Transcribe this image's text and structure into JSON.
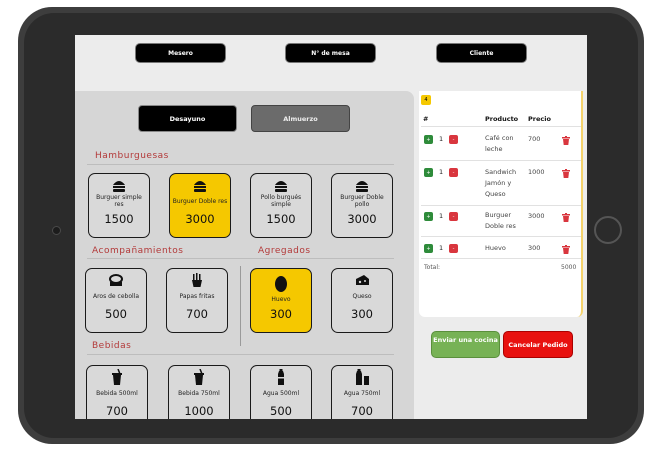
{
  "header": {
    "waiter_label": "Mesero",
    "table_label": "N° de mesa",
    "client_label": "Cliente"
  },
  "tabs": [
    {
      "label": "Desayuno",
      "active": true
    },
    {
      "label": "Almuerzo",
      "active": false
    }
  ],
  "sections": {
    "burgers": "Hamburguesas",
    "sides": "Acompañamientos",
    "extras": "Agregados",
    "drinks": "Bebidas"
  },
  "products": {
    "burgers": [
      {
        "name": "Burguer simple res",
        "price": "1500",
        "icon": "burger-icon",
        "selected": false
      },
      {
        "name": "Burguer Doble res",
        "price": "3000",
        "icon": "burger-icon",
        "selected": true
      },
      {
        "name": "Pollo burgués simple",
        "price": "1500",
        "icon": "burger-icon",
        "selected": false
      },
      {
        "name": "Burguer Doble pollo",
        "price": "3000",
        "icon": "burger-icon",
        "selected": false
      }
    ],
    "sides": [
      {
        "name": "Aros de cebolla",
        "price": "500",
        "icon": "onion-rings-icon",
        "selected": false
      },
      {
        "name": "Papas fritas",
        "price": "700",
        "icon": "fries-icon",
        "selected": false
      }
    ],
    "extras": [
      {
        "name": "Huevo",
        "price": "300",
        "icon": "egg-icon",
        "selected": true
      },
      {
        "name": "Queso",
        "price": "300",
        "icon": "cheese-icon",
        "selected": false
      }
    ],
    "drinks": [
      {
        "name": "Bebida 500ml",
        "price": "700",
        "icon": "cup-icon",
        "selected": false
      },
      {
        "name": "Bebida 750ml",
        "price": "1000",
        "icon": "cup-icon",
        "selected": false
      },
      {
        "name": "Agua 500ml",
        "price": "500",
        "icon": "water-bottle-icon",
        "selected": false
      },
      {
        "name": "Agua 750ml",
        "price": "700",
        "icon": "water-bottle-icon",
        "selected": false
      }
    ]
  },
  "order": {
    "badge": "4",
    "columns": {
      "num": "#",
      "product": "Producto",
      "price": "Precio"
    },
    "plus": "+",
    "minus": "-",
    "items": [
      {
        "qty": "1",
        "product": "Café con leche",
        "price": "700"
      },
      {
        "qty": "1",
        "product": "Sandwich Jamón y Queso",
        "price": "1000"
      },
      {
        "qty": "1",
        "product": "Burguer Doble res",
        "price": "3000"
      },
      {
        "qty": "1",
        "product": "Huevo",
        "price": "300"
      }
    ],
    "total_label": "Total:",
    "total_value": "5000"
  },
  "actions": {
    "send_label": "Enviar una cocina",
    "cancel_label": "Cancelar Pedido"
  },
  "colors": {
    "selected": "#f5c800",
    "section_title": "#b33a3a",
    "send": "#77b255",
    "cancel": "#e8110f"
  }
}
